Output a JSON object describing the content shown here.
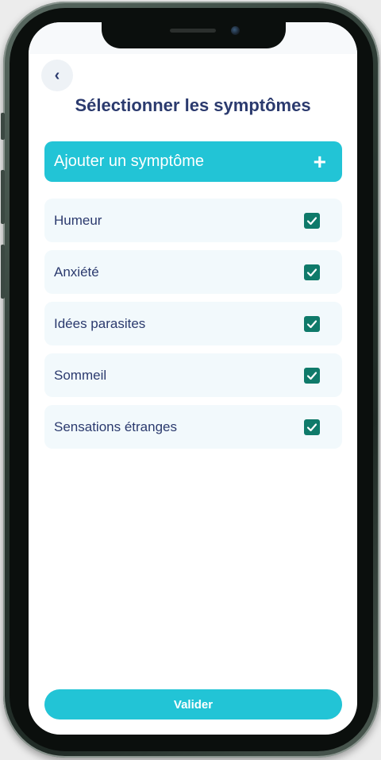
{
  "colors": {
    "accent": "#22c4d6",
    "title": "#2b3a6e",
    "item_bg": "#f2f9fc",
    "checkbox": "#0f7a6a"
  },
  "header": {
    "back_icon": "chevron-left-icon",
    "back_glyph": "‹",
    "title": "Sélectionner les symptômes"
  },
  "add_button": {
    "label": "Ajouter un symptôme",
    "icon": "plus-icon",
    "glyph": "+"
  },
  "symptoms": [
    {
      "label": "Humeur",
      "checked": true
    },
    {
      "label": "Anxiété",
      "checked": true
    },
    {
      "label": "Idées parasites",
      "checked": true
    },
    {
      "label": "Sommeil",
      "checked": true
    },
    {
      "label": "Sensations étranges",
      "checked": true
    }
  ],
  "footer": {
    "validate_label": "Valider"
  }
}
